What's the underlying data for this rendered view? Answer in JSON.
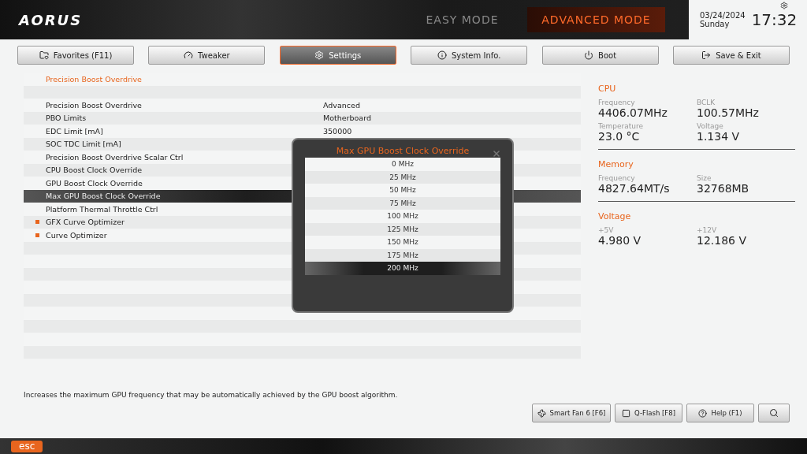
{
  "header": {
    "logo": "AORUS",
    "modes": [
      {
        "label": "EASY MODE",
        "selected": false
      },
      {
        "label": "ADVANCED MODE",
        "selected": true
      }
    ],
    "date": "03/24/2024",
    "day": "Sunday",
    "time": "17:32"
  },
  "tabs": [
    {
      "label": "Favorites (F11)",
      "selected": false
    },
    {
      "label": "Tweaker",
      "selected": false
    },
    {
      "label": "Settings",
      "selected": true
    },
    {
      "label": "System Info.",
      "selected": false
    },
    {
      "label": "Boot",
      "selected": false
    },
    {
      "label": "Save & Exit",
      "selected": false
    }
  ],
  "settings": {
    "title": "Precision Boost Overdrive",
    "rows": [
      {
        "label": "Precision Boost Overdrive",
        "value": "Advanced",
        "bullet": false,
        "selected": false
      },
      {
        "label": "PBO Limits",
        "value": "Motherboard",
        "bullet": false,
        "selected": false
      },
      {
        "label": "EDC Limit [mA]",
        "value": "350000",
        "bullet": false,
        "selected": false
      },
      {
        "label": "SOC TDC Limit [mA]",
        "bullet": false,
        "selected": false
      },
      {
        "label": "Precision Boost Overdrive Scalar Ctrl",
        "bullet": false,
        "selected": false
      },
      {
        "label": "CPU Boost Clock Override",
        "bullet": false,
        "selected": false
      },
      {
        "label": "GPU Boost Clock Override",
        "bullet": false,
        "selected": false
      },
      {
        "label": "Max GPU Boost Clock Override",
        "bullet": false,
        "selected": true
      },
      {
        "label": "Platform Thermal Throttle Ctrl",
        "bullet": false,
        "selected": false
      },
      {
        "label": "GFX Curve Optimizer",
        "bullet": true,
        "selected": false
      },
      {
        "label": "Curve Optimizer",
        "bullet": true,
        "selected": false
      }
    ]
  },
  "popup": {
    "title": "Max GPU Boost Clock Override",
    "options": [
      {
        "label": "0 MHz",
        "selected": false
      },
      {
        "label": "25 MHz",
        "selected": false
      },
      {
        "label": "50 MHz",
        "selected": false
      },
      {
        "label": "75 MHz",
        "selected": false
      },
      {
        "label": "100 MHz",
        "selected": false
      },
      {
        "label": "125 MHz",
        "selected": false
      },
      {
        "label": "150 MHz",
        "selected": false
      },
      {
        "label": "175 MHz",
        "selected": false
      },
      {
        "label": "200 MHz",
        "selected": true
      }
    ]
  },
  "monitor": [
    {
      "title": "CPU",
      "fields": [
        {
          "label": "Frequency",
          "value": "4406.07MHz"
        },
        {
          "label": "BCLK",
          "value": "100.57MHz"
        },
        {
          "label": "Temperature",
          "value": "23.0 °C"
        },
        {
          "label": "Voltage",
          "value": "1.134 V"
        }
      ]
    },
    {
      "title": "Memory",
      "fields": [
        {
          "label": "Frequency",
          "value": "4827.64MT/s"
        },
        {
          "label": "Size",
          "value": "32768MB"
        }
      ]
    },
    {
      "title": "Voltage",
      "fields": [
        {
          "label": "+5V",
          "value": "4.980 V"
        },
        {
          "label": "+12V",
          "value": "12.186 V"
        }
      ]
    }
  ],
  "description": "Increases the maximum GPU frequency that may be automatically achieved by the GPU boost algorithm.",
  "tools": [
    "Smart Fan 6 [F6]",
    "Q-Flash [F8]",
    "Help (F1)"
  ],
  "esc": "esc"
}
